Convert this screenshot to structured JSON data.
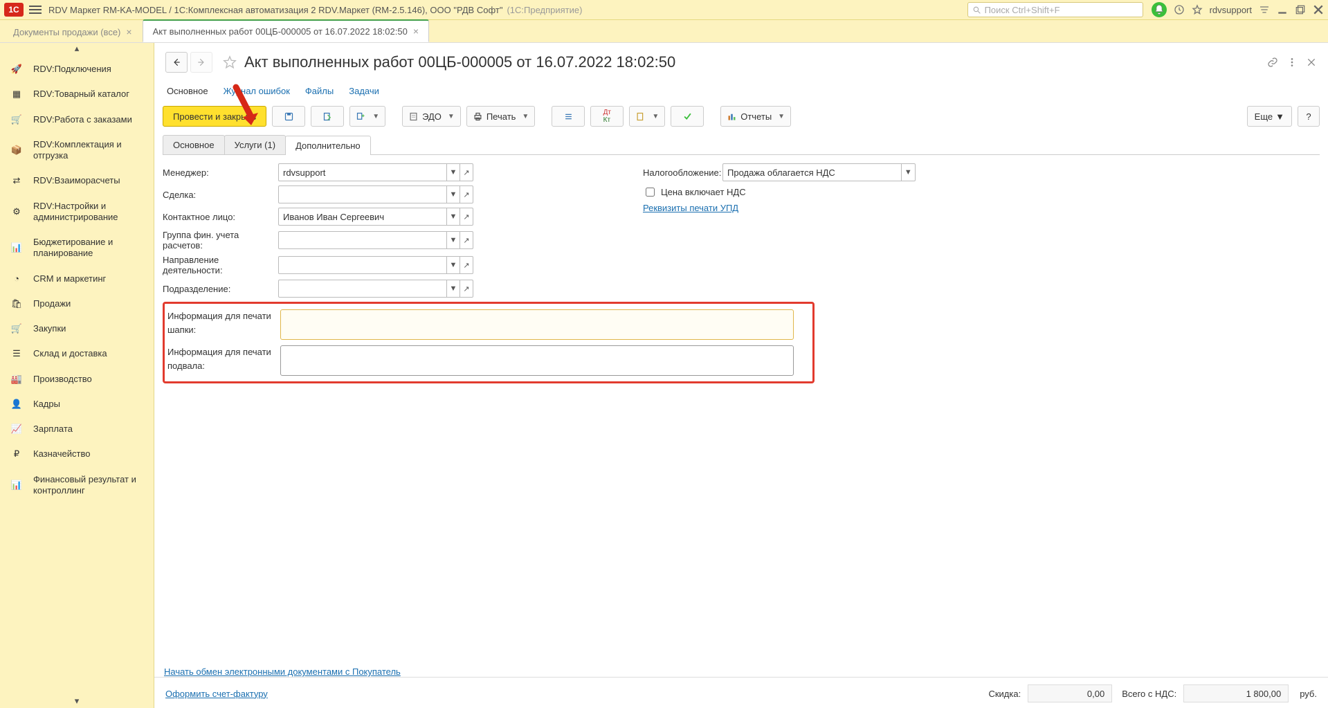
{
  "topbar": {
    "logo": "1C",
    "title": "RDV Маркет RM-KA-MODEL / 1С:Комплексная автоматизация 2 RDV.Маркет (RM-2.5.146), ООО \"РДВ Софт\"",
    "suffix": "(1С:Предприятие)",
    "search_placeholder": "Поиск Ctrl+Shift+F",
    "user": "rdvsupport"
  },
  "tabs": [
    {
      "label": "Документы продажи (все)",
      "active": false
    },
    {
      "label": "Акт выполненных работ 00ЦБ-000005 от 16.07.2022 18:02:50",
      "active": true
    }
  ],
  "sidebar": {
    "items": [
      {
        "icon": "🚀",
        "label": "RDV:Подключения"
      },
      {
        "icon": "▦",
        "label": "RDV:Товарный каталог"
      },
      {
        "icon": "🛒",
        "label": "RDV:Работа с заказами"
      },
      {
        "icon": "📦",
        "label": "RDV:Комплектация и отгрузка"
      },
      {
        "icon": "⇄",
        "label": "RDV:Взаиморасчеты"
      },
      {
        "icon": "⚙",
        "label": "RDV:Настройки и администрирование"
      },
      {
        "icon": "📊",
        "label": "Бюджетирование и планирование"
      },
      {
        "icon": "◔",
        "label": "CRM и маркетинг"
      },
      {
        "icon": "🛍",
        "label": "Продажи"
      },
      {
        "icon": "🛒",
        "label": "Закупки"
      },
      {
        "icon": "☰",
        "label": "Склад и доставка"
      },
      {
        "icon": "🏭",
        "label": "Производство"
      },
      {
        "icon": "👤",
        "label": "Кадры"
      },
      {
        "icon": "📈",
        "label": "Зарплата"
      },
      {
        "icon": "₽",
        "label": "Казначейство"
      },
      {
        "icon": "📊",
        "label": "Финансовый результат и контроллинг"
      }
    ]
  },
  "doc": {
    "title": "Акт выполненных работ 00ЦБ-000005 от 16.07.2022 18:02:50"
  },
  "subnav": {
    "main": "Основное",
    "errors": "Журнал ошибок",
    "files": "Файлы",
    "tasks": "Задачи"
  },
  "toolbar": {
    "post_close": "Провести и закрыть",
    "edo": "ЭДО",
    "print": "Печать",
    "reports": "Отчеты",
    "more": "Еще",
    "help": "?"
  },
  "inner_tabs": {
    "t1": "Основное",
    "t2": "Услуги (1)",
    "t3": "Дополнительно"
  },
  "form": {
    "manager_label": "Менеджер:",
    "manager_value": "rdvsupport",
    "deal_label": "Сделка:",
    "deal_value": "",
    "contact_label": "Контактное лицо:",
    "contact_value": "Иванов Иван Сергеевич",
    "fingroup_label": "Группа фин. учета расчетов:",
    "fingroup_value": "",
    "activity_label": "Направление деятельности:",
    "activity_value": "",
    "dept_label": "Подразделение:",
    "dept_value": "",
    "tax_label": "Налогообложение:",
    "tax_value": "Продажа облагается НДС",
    "price_includes_vat": "Цена включает НДС",
    "upd_link": "Реквизиты печати УПД",
    "info_header_label": "Информация для печати шапки:",
    "info_footer_label": "Информация для печати подвала:"
  },
  "footer_links": {
    "l1": "Начать обмен электронными документами с Покупатель",
    "l2": "Оформить счет-фактуру"
  },
  "status": {
    "discount_label": "Скидка:",
    "discount_value": "0,00",
    "total_label": "Всего с НДС:",
    "total_value": "1 800,00",
    "currency": "руб."
  }
}
